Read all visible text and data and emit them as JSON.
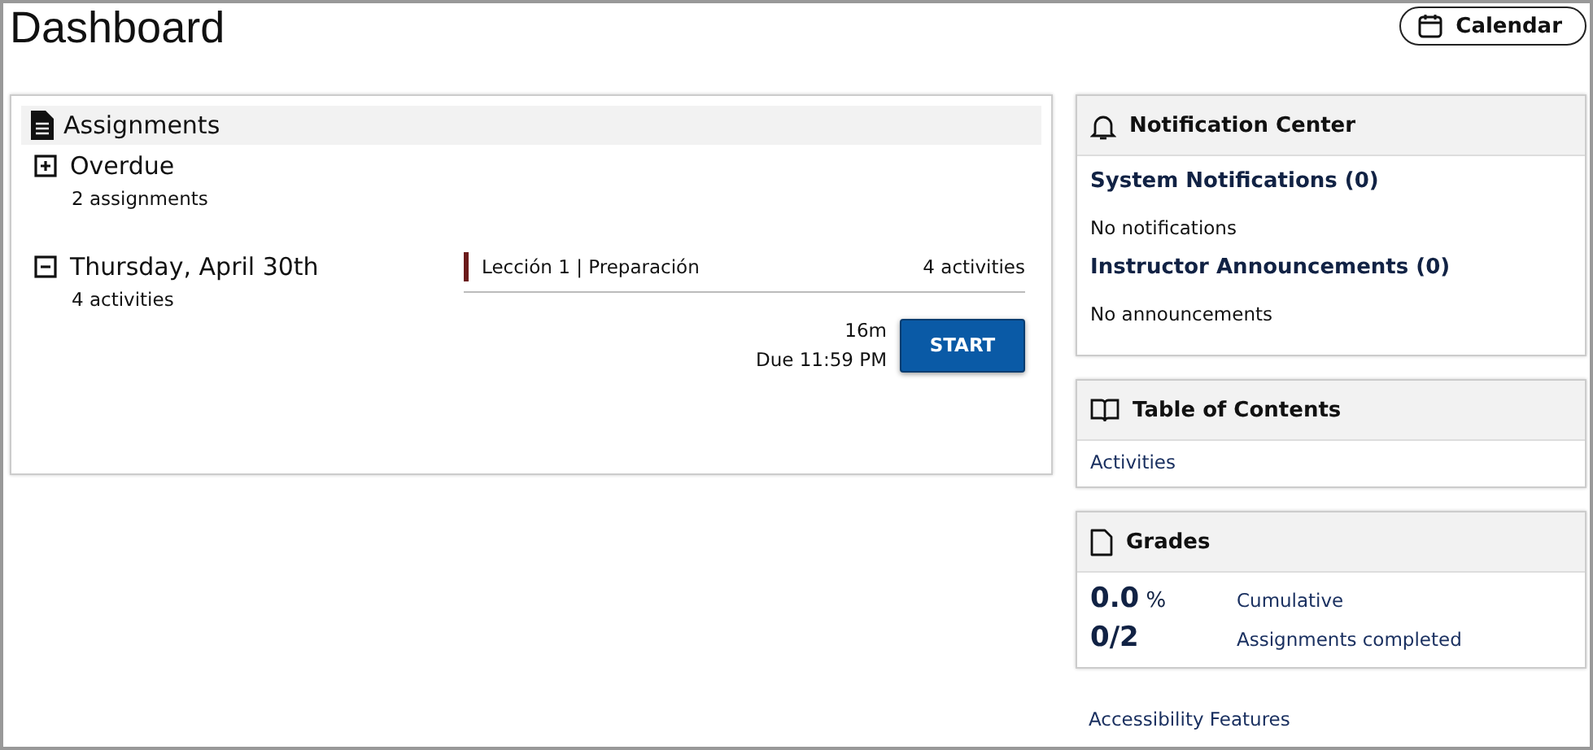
{
  "title": "Dashboard",
  "calendar_button": "Calendar",
  "assignments": {
    "title": "Assignments",
    "groups": [
      {
        "label": "Overdue",
        "count": "2 assignments",
        "expanded": false
      },
      {
        "label": "Thursday, April 30th",
        "count": "4 activities",
        "expanded": true,
        "lesson": {
          "name": "Lección 1",
          "separator": "|",
          "section": "Preparación",
          "count": "4 activities",
          "color": "#6b1a1a"
        },
        "duration": "16m",
        "due": "Due 11:59 PM",
        "button": "START"
      }
    ]
  },
  "notification_center": {
    "title": "Notification Center",
    "sections": [
      {
        "heading": "System Notifications (0)",
        "message": "No notifications"
      },
      {
        "heading": "Instructor Announcements (0)",
        "message": "No announcements"
      }
    ]
  },
  "table_of_contents": {
    "title": "Table of Contents",
    "links": [
      "Activities"
    ]
  },
  "grades": {
    "title": "Grades",
    "rows": [
      {
        "value": "0.0",
        "unit": "%",
        "label": "Cumulative"
      },
      {
        "value": "0/2",
        "label": "Assignments completed"
      }
    ]
  },
  "footer_link": "Accessibility Features"
}
